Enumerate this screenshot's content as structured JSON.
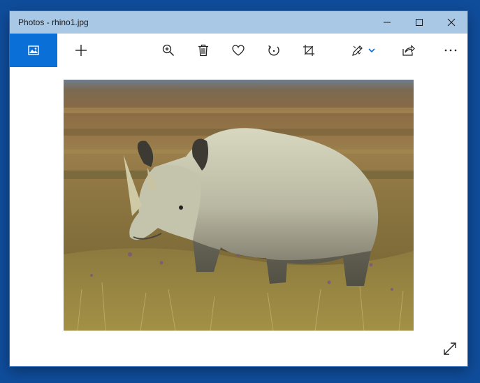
{
  "window": {
    "title": "Photos - rhino1.jpg"
  },
  "title_controls": {
    "minimize_icon": "minimize-icon",
    "maximize_icon": "maximize-icon",
    "close_icon": "close-icon"
  },
  "toolbar": {
    "items": [
      {
        "name": "collection",
        "icon": "image-icon",
        "active": true
      },
      {
        "name": "add",
        "icon": "plus-icon"
      },
      {
        "name": "zoom",
        "icon": "zoom-in-icon"
      },
      {
        "name": "delete",
        "icon": "trash-icon"
      },
      {
        "name": "favorite",
        "icon": "heart-icon"
      },
      {
        "name": "rotate",
        "icon": "rotate-icon"
      },
      {
        "name": "crop",
        "icon": "crop-icon"
      },
      {
        "name": "edit-create",
        "icon": "pen-icon"
      },
      {
        "name": "share",
        "icon": "share-icon"
      },
      {
        "name": "more",
        "icon": "more-icon"
      }
    ]
  },
  "photo": {
    "subject": "rhino1.jpg"
  },
  "colors": {
    "titlebar": "#a9c8e6",
    "accent": "#0a6fd6",
    "desktop": "#0f4c9a"
  }
}
